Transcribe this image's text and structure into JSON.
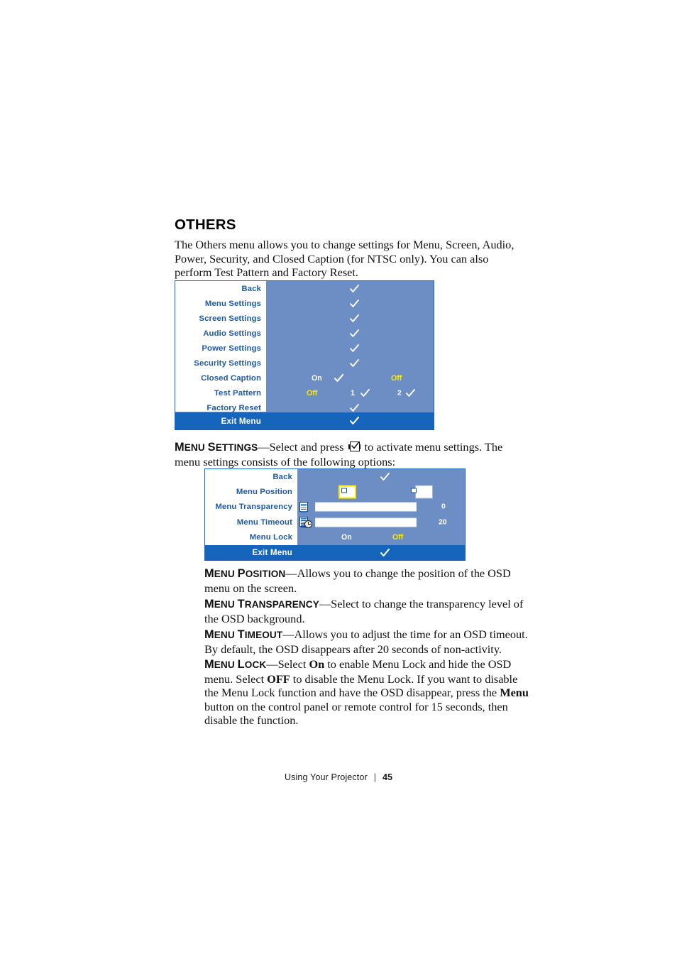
{
  "page": {
    "section_title": "OTHERS",
    "intro": "The Others menu allows you to change settings for Menu, Screen, Audio, Power, Security, and Closed Caption (for NTSC only). You can also perform Test Pattern and Factory Reset."
  },
  "osd_others": {
    "rows": [
      {
        "label": "Back",
        "check": true
      },
      {
        "label": "Menu Settings",
        "check": true
      },
      {
        "label": "Screen Settings",
        "check": true
      },
      {
        "label": "Audio Settings",
        "check": true
      },
      {
        "label": "Power Settings",
        "check": true
      },
      {
        "label": "Security Settings",
        "check": true
      },
      {
        "label": "Closed Caption",
        "opt_on": "On",
        "opt_off": "Off"
      },
      {
        "label": "Test Pattern",
        "opt_off": "Off",
        "opt_1": "1",
        "opt_2": "2"
      },
      {
        "label": "Factory Reset",
        "check": true
      }
    ],
    "exit_label": "Exit Menu",
    "colors": {
      "panel": "#6d8ec4",
      "label_col": "#ffffff",
      "label_text": "#1f5ba8",
      "exit_bar": "#1565bd",
      "highlight_yellow": "#ffe800"
    }
  },
  "menu_settings_lead": {
    "term": "Menu Settings",
    "term_caps": "M",
    "text_before_icon": "—Select and press ",
    "icon": "checkbox-enter-icon",
    "text_after_icon": " to activate menu settings. The menu settings consists of the following options:"
  },
  "osd_menu_settings": {
    "rows": [
      {
        "label": "Back",
        "check": true
      },
      {
        "label": "Menu Position",
        "positions": [
          "top-left",
          "top-right"
        ],
        "selected": 0
      },
      {
        "label": "Menu Transparency",
        "icon": "transparency-icon",
        "slider_pct": 50,
        "value": "0"
      },
      {
        "label": "Menu Timeout",
        "icon": "timeout-clock-icon",
        "slider_pct": 40,
        "value": "20"
      },
      {
        "label": "Menu Lock",
        "opt_on": "On",
        "opt_off": "Off"
      }
    ],
    "exit_label": "Exit Menu"
  },
  "descriptions": [
    {
      "term": "Menu Position",
      "body": "—Allows you to change the position of the OSD menu on the screen."
    },
    {
      "term": "Menu Transparency",
      "body": "—Select to change the transparency level of the OSD background."
    },
    {
      "term": "Menu Timeout",
      "body": "—Allows you to adjust the time for an OSD timeout. By default, the OSD disappears after 20 seconds of non-activity."
    }
  ],
  "menu_lock_desc": {
    "term": "Menu Lock",
    "seg1": "—Select ",
    "b1": "On",
    "seg2": " to enable Menu Lock and hide the OSD menu. Select ",
    "b2": "OFF",
    "seg3": " to disable the Menu Lock. If you want to disable the Menu Lock function and have the OSD disappear, press the ",
    "b3": "Menu",
    "seg4": " button on the control panel or remote control for 15 seconds, then disable the function."
  },
  "footer": {
    "label": "Using Your Projector",
    "separator": "|",
    "page_number": "45"
  }
}
